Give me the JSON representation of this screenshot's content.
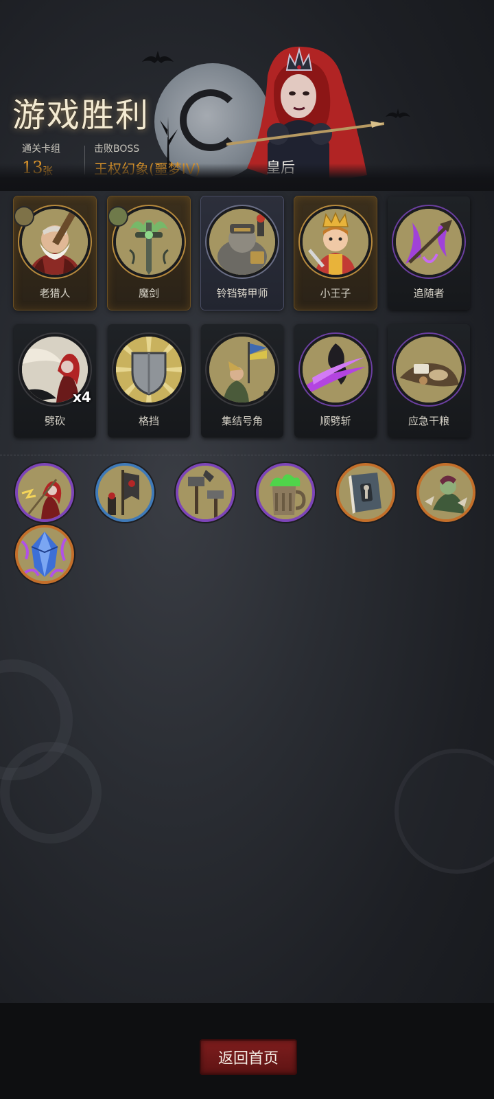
{
  "header": {
    "title": "游戏胜利",
    "deck_label": "通关卡组",
    "deck_count": "13",
    "deck_unit": "张",
    "boss_label": "击败BOSS",
    "boss_stage": "王权幻象(噩梦IV)",
    "boss_name": "皇后"
  },
  "cards_row1": [
    {
      "label": "老猎人",
      "frame": "gold",
      "icon": "old-hunter-icon"
    },
    {
      "label": "魔剑",
      "frame": "gold",
      "icon": "demon-sword-icon"
    },
    {
      "label": "铃铛铸甲师",
      "frame": "steel",
      "icon": "bell-armorer-icon"
    },
    {
      "label": "小王子",
      "frame": "gold",
      "icon": "little-prince-icon"
    },
    {
      "label": "追随者",
      "frame": "dark",
      "icon": "follower-icon"
    }
  ],
  "cards_row2": [
    {
      "label": "劈砍",
      "frame": "dark",
      "icon": "hack-icon",
      "count": "x4"
    },
    {
      "label": "格挡",
      "frame": "dark",
      "icon": "block-icon"
    },
    {
      "label": "集结号角",
      "frame": "dark",
      "icon": "rally-horn-icon"
    },
    {
      "label": "顺劈斩",
      "frame": "dark",
      "icon": "cleave-icon"
    },
    {
      "label": "应急干粮",
      "frame": "dark",
      "icon": "emergency-rations-icon"
    }
  ],
  "relics": [
    {
      "icon": "queen-strike-relic-icon",
      "rarity": "purple"
    },
    {
      "icon": "banner-relic-icon",
      "rarity": "blue"
    },
    {
      "icon": "hammer-relic-icon",
      "rarity": "purple"
    },
    {
      "icon": "poison-mug-relic-icon",
      "rarity": "purple"
    },
    {
      "icon": "tome-relic-icon",
      "rarity": "orange"
    },
    {
      "icon": "goblin-relic-icon",
      "rarity": "orange"
    },
    {
      "icon": "crystal-relic-icon",
      "rarity": "orange"
    }
  ],
  "footer": {
    "home_button": "返回首页"
  },
  "colors": {
    "accent_orange": "#e39a2c",
    "button_red": "#7d1d1d",
    "title_cream": "#f3ead2"
  }
}
